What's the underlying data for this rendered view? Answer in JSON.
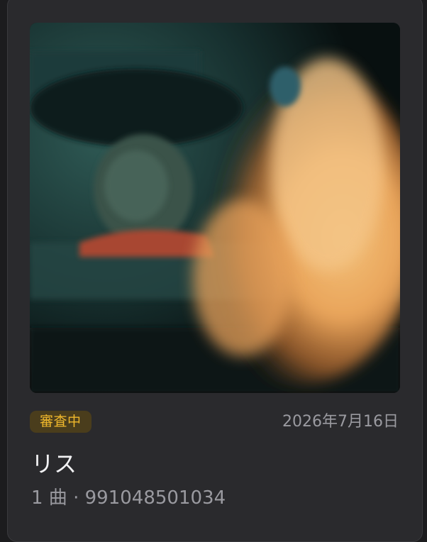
{
  "album": {
    "artwork_icon": "album-artwork-image",
    "status_label": "審査中",
    "release_date": "2026年7月16日",
    "title": "リス",
    "track_count": "1 曲",
    "separator": "·",
    "catalog_number": "991048501034"
  },
  "colors": {
    "background": "#1c1c1e",
    "card": "#2a2a2d",
    "status_badge_bg": "#4a3d1c",
    "status_badge_text": "#f0b82c",
    "secondary_text": "#9a9aa0",
    "primary_text": "#f2f2f4"
  }
}
